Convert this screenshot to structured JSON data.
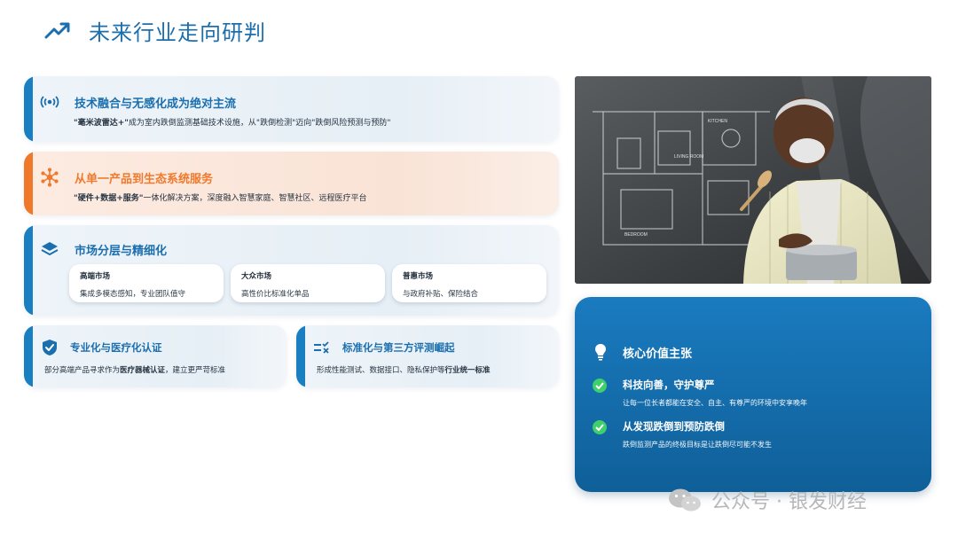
{
  "page": {
    "title": "未来行业走向研判"
  },
  "cards": [
    {
      "title": "技术融合与无感化成为绝对主流",
      "desc_bold": "\"毫米波雷达+\"",
      "desc_rest": "成为室内跌倒监测基础技术设施，从\"跌倒检测\"迈向\"跌倒风险预测与预防\""
    },
    {
      "title": "从单一产品到生态系统服务",
      "desc_bold": "\"硬件+数据+服务\"",
      "desc_rest": "一体化解决方案，深度融入智慧家庭、智慧社区、远程医疗平台"
    },
    {
      "title": "市场分层与精细化",
      "markets": [
        {
          "name": "高端市场",
          "desc": "集成多模态感知，专业团队值守"
        },
        {
          "name": "大众市场",
          "desc": "高性价比标准化单品"
        },
        {
          "name": "普惠市场",
          "desc": "与政府补贴、保险结合"
        }
      ]
    },
    {
      "title": "专业化与医疗化认证",
      "desc_pre": "部分高端产品寻求作为",
      "desc_bold": "医疗器械认证",
      "desc_post": "，建立更严苛标准"
    },
    {
      "title": "标准化与第三方评测崛起",
      "desc_pre": "形成性能测试、数据接口、隐私保护等",
      "desc_bold": "行业统一标准",
      "desc_post": ""
    }
  ],
  "value_panel": {
    "title": "核心价值主张",
    "items": [
      {
        "title": "科技向善，守护尊严",
        "desc": "让每一位长者都能在安全、自主、有尊严的环境中安享晚年"
      },
      {
        "title": "从发现跌倒到预防跌倒",
        "desc": "跌倒监测产品的终极目标是让跌倒尽可能不发生"
      }
    ]
  },
  "photo": {
    "labels": [
      "KITCHEN",
      "LIVING ROOM",
      "BEDROOM"
    ]
  },
  "watermark": "公众号 · 银发财经",
  "colors": {
    "accent_blue": "#1a7fc1",
    "accent_orange": "#f0782b",
    "panel_blue": "#1469a8",
    "check_green": "#3fcf6b"
  }
}
